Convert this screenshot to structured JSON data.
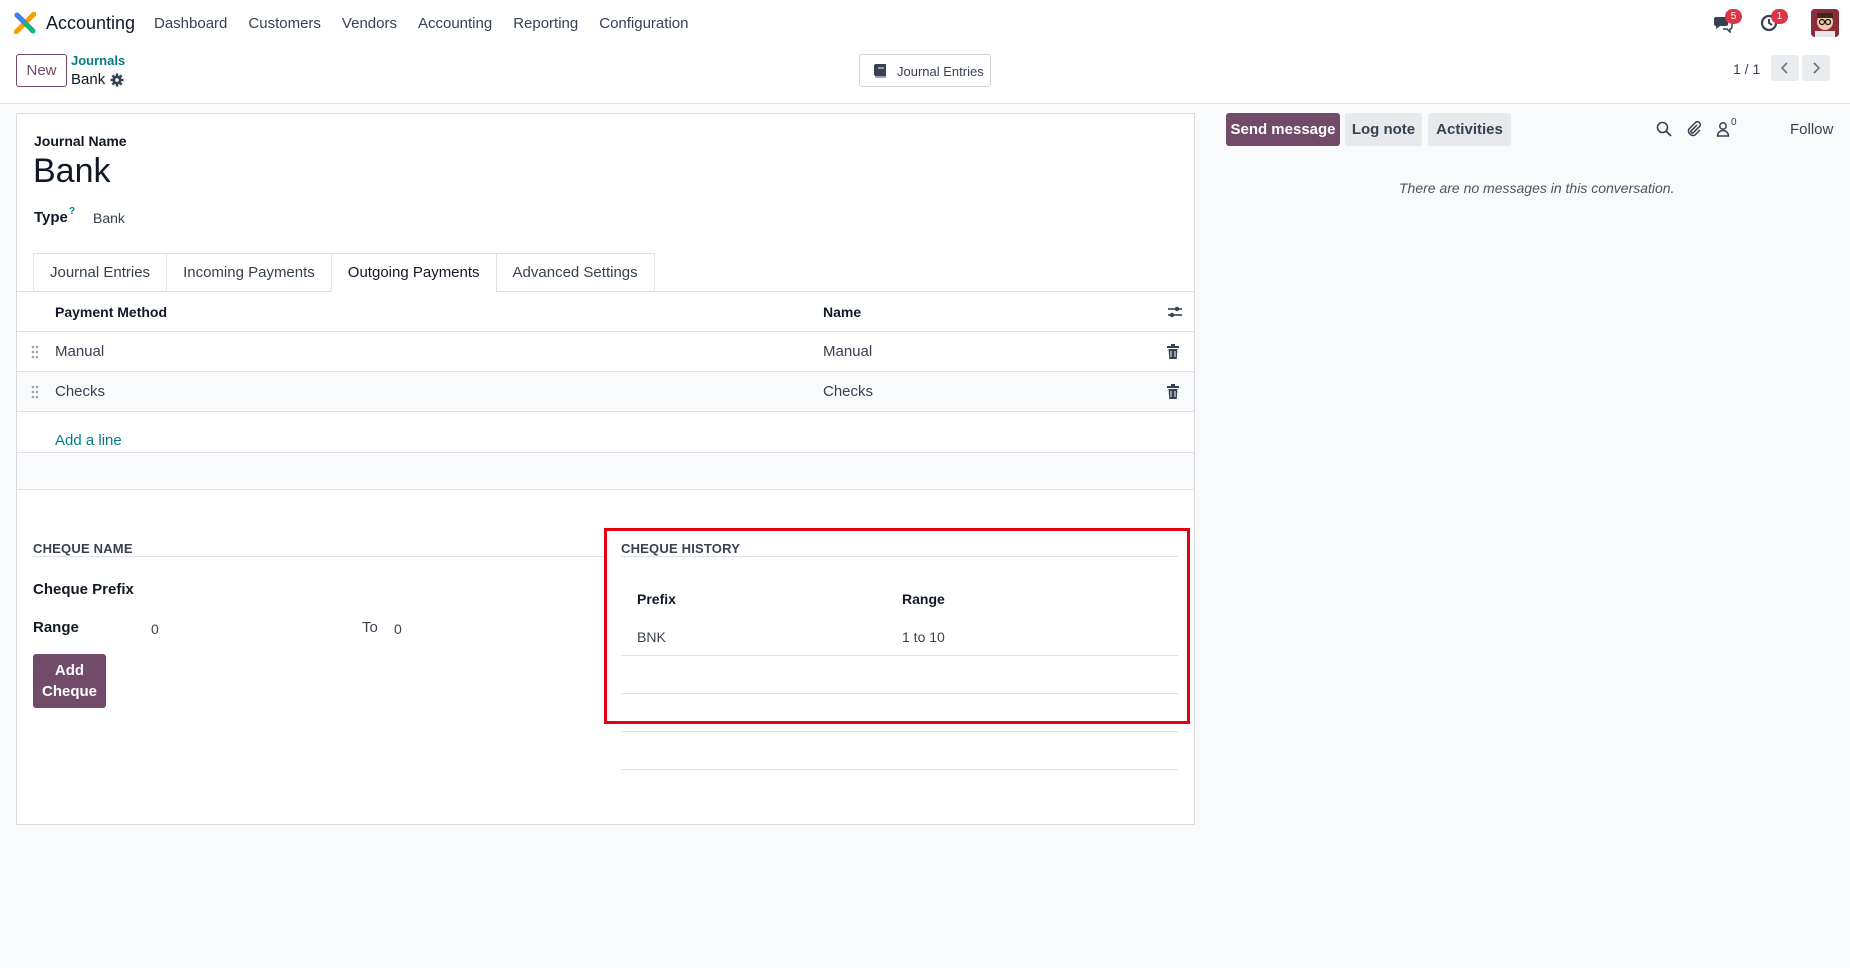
{
  "app": {
    "name": "Accounting"
  },
  "menu": [
    "Dashboard",
    "Customers",
    "Vendors",
    "Accounting",
    "Reporting",
    "Configuration"
  ],
  "systray": {
    "messages_count": "5",
    "activities_count": "1"
  },
  "control": {
    "new_label": "New",
    "breadcrumb_parent": "Journals",
    "breadcrumb_current": "Bank",
    "smart_button": "Journal Entries",
    "pager": "1 / 1"
  },
  "form": {
    "journal_name_label": "Journal Name",
    "journal_name": "Bank",
    "type_label": "Type",
    "type_help": "?",
    "type_value": "Bank"
  },
  "tabs": [
    {
      "label": "Journal Entries",
      "active": false
    },
    {
      "label": "Incoming Payments",
      "active": false
    },
    {
      "label": "Outgoing Payments",
      "active": true
    },
    {
      "label": "Advanced Settings",
      "active": false
    }
  ],
  "payment_methods": {
    "columns": [
      "Payment Method",
      "Name"
    ],
    "rows": [
      {
        "method": "Manual",
        "name": "Manual"
      },
      {
        "method": "Checks",
        "name": "Checks"
      }
    ],
    "add_line": "Add a line"
  },
  "cheque_name": {
    "section_title": "CHEQUE NAME",
    "prefix_label": "Cheque Prefix",
    "range_label": "Range",
    "range_from": "0",
    "to_label": "To",
    "range_to": "0",
    "add_button": "Add Cheque"
  },
  "cheque_history": {
    "section_title": "CHEQUE HISTORY",
    "columns": [
      "Prefix",
      "Range"
    ],
    "rows": [
      {
        "prefix": "BNK",
        "range": "1 to 10"
      }
    ]
  },
  "chatter": {
    "send_message": "Send message",
    "log_note": "Log note",
    "activities": "Activities",
    "followers_count": "0",
    "follow": "Follow",
    "empty_text": "There are no messages in this conversation."
  },
  "colors": {
    "brand": "#714B67",
    "link": "#017e84",
    "highlight": "#e3000f"
  }
}
